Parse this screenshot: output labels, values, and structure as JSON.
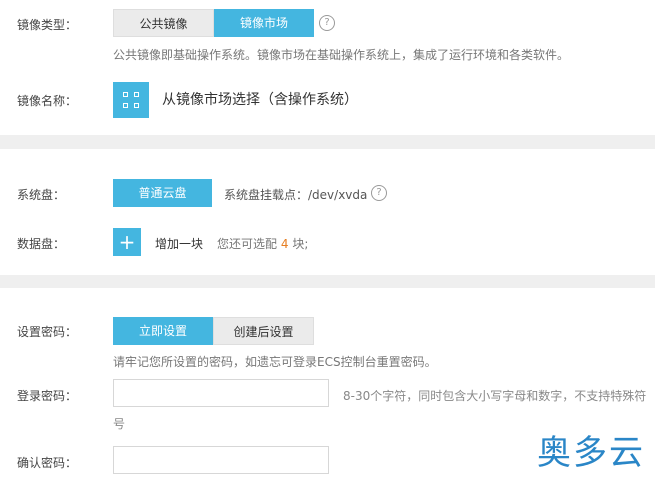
{
  "image": {
    "type_label": "镜像类型：",
    "tabs": [
      {
        "label": "公共镜像",
        "selected": false
      },
      {
        "label": "镜像市场",
        "selected": true
      }
    ],
    "description": "公共镜像即基础操作系统。镜像市场在基础操作系统上，集成了运行环境和各类软件。",
    "name_label": "镜像名称：",
    "select_text": "从镜像市场选择（含操作系统）"
  },
  "disk": {
    "system_label": "系统盘：",
    "system_type": "普通云盘",
    "mount_point": "系统盘挂载点：/dev/xvda",
    "data_label": "数据盘：",
    "add_label": "增加一块",
    "remaining_prefix": "您还可选配",
    "remaining_count": "4",
    "remaining_suffix": "块;"
  },
  "password": {
    "set_label": "设置密码：",
    "options": [
      {
        "label": "立即设置",
        "selected": true
      },
      {
        "label": "创建后设置",
        "selected": false
      }
    ],
    "reminder": "请牢记您所设置的密码，如遗忘可登录ECS控制台重置密码。",
    "login_label": "登录密码：",
    "login_hint_line1": "8-30个字符，同时包含大小写字母和数字，不支持特殊符",
    "login_hint_line2": "号",
    "confirm_label": "确认密码："
  },
  "watermark": "奥多云",
  "colors": {
    "accent": "#44b6e0",
    "count": "#e67e22",
    "watermark": "#2a86c7"
  }
}
